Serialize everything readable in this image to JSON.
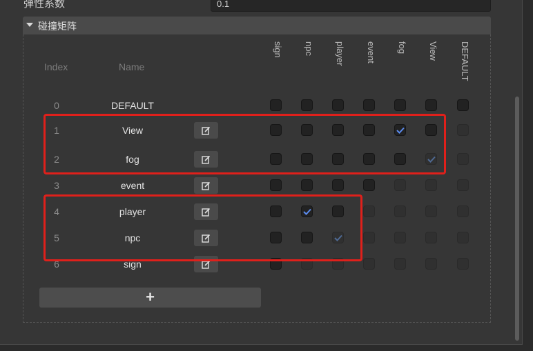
{
  "top_property": {
    "label": "弹性系数",
    "value": "0.1"
  },
  "section": {
    "title": "碰撞矩阵"
  },
  "table": {
    "index_header": "Index",
    "name_header": "Name",
    "columns": [
      "sign",
      "npc",
      "player",
      "event",
      "fog",
      "View",
      "DEFAULT"
    ],
    "rows": [
      {
        "index": "0",
        "name": "DEFAULT"
      },
      {
        "index": "1",
        "name": "View"
      },
      {
        "index": "2",
        "name": "fog"
      },
      {
        "index": "3",
        "name": "event"
      },
      {
        "index": "4",
        "name": "player"
      },
      {
        "index": "5",
        "name": "npc"
      },
      {
        "index": "6",
        "name": "sign"
      }
    ],
    "checked": [
      {
        "row": 1,
        "col": 4,
        "state": "checked"
      },
      {
        "row": 2,
        "col": 5,
        "state": "mirror"
      },
      {
        "row": 4,
        "col": 1,
        "state": "checked"
      },
      {
        "row": 5,
        "col": 2,
        "state": "mirror"
      }
    ]
  },
  "add_button": {
    "label": "+"
  },
  "colors": {
    "highlight": "#e0201b",
    "check_accent": "#5b8cf0",
    "panel": "#363636"
  }
}
